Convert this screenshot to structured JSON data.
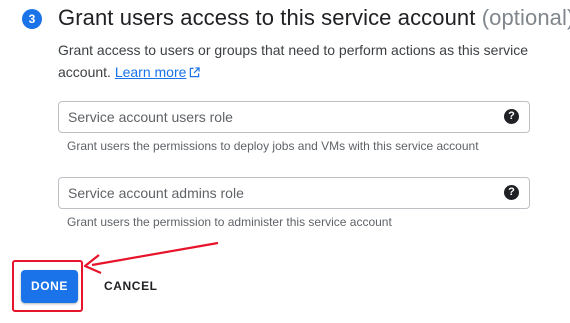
{
  "step": {
    "number": "3",
    "title": "Grant users access to this service account",
    "optional": "(optional)"
  },
  "description": {
    "text": "Grant access to users or groups that need to perform actions as this service account.",
    "link": "Learn more"
  },
  "fields": [
    {
      "placeholder": "Service account users role",
      "hint": "Grant users the permissions to deploy jobs and VMs with this service account"
    },
    {
      "placeholder": "Service account admins role",
      "hint": "Grant users the permission to administer this service account"
    }
  ],
  "buttons": {
    "done": "DONE",
    "cancel": "CANCEL"
  },
  "colors": {
    "accent": "#1a73e8",
    "annotation": "#e8142c"
  },
  "icons": {
    "help": "help-circle-icon",
    "external": "external-link-icon"
  }
}
